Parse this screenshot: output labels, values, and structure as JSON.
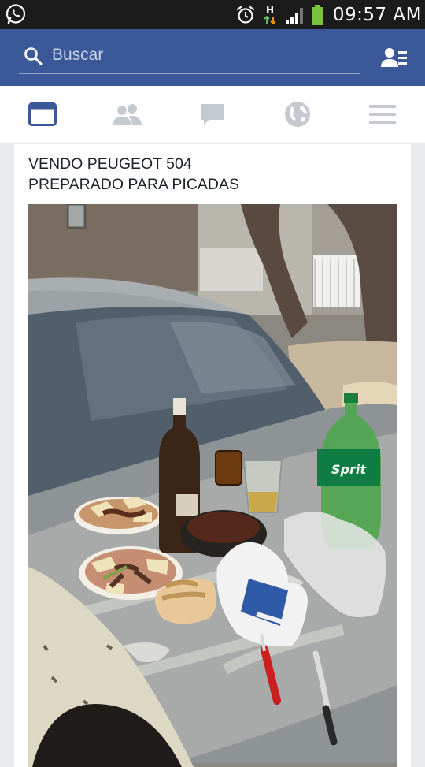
{
  "status_bar": {
    "time": "09:57 AM",
    "network_label": "H",
    "icons": [
      "whatsapp-icon",
      "alarm-icon",
      "network-h-icon",
      "signal-icon",
      "battery-icon"
    ]
  },
  "header": {
    "search_placeholder": "Buscar",
    "icons": [
      "search-icon",
      "friend-requests-icon"
    ]
  },
  "tabs": [
    {
      "name": "news-feed",
      "icon": "news-feed-icon",
      "active": true
    },
    {
      "name": "friends",
      "icon": "friends-icon",
      "active": false
    },
    {
      "name": "messages",
      "icon": "messages-icon",
      "active": false
    },
    {
      "name": "notifications",
      "icon": "globe-icon",
      "active": false
    },
    {
      "name": "more",
      "icon": "menu-icon",
      "active": false
    }
  ],
  "post": {
    "text_line1": "VENDO PEUGEOT 504",
    "text_line2": "PREPARADO PARA PICADAS",
    "photo_bottle_label": "Sprit"
  },
  "colors": {
    "brand": "#3b5998",
    "status_bar": "#1b1b1b",
    "active_tab": "#3b5998",
    "inactive_tab": "#c5c9d0"
  }
}
